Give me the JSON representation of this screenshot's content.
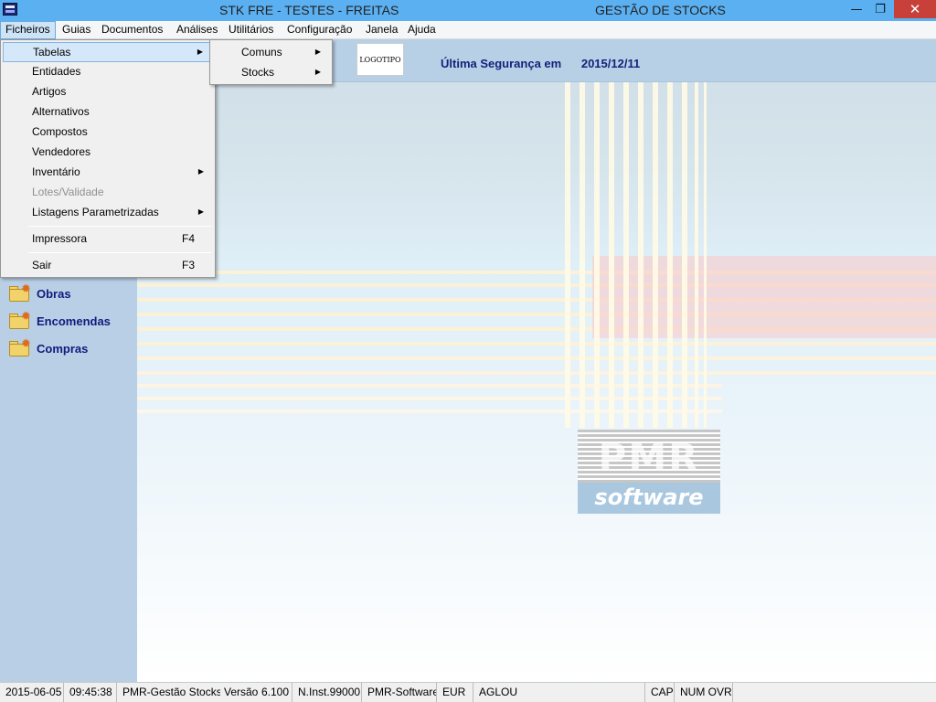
{
  "window": {
    "title_left": "STK FRE - TESTES - FREITAS",
    "title_right": "GESTÃO DE STOCKS",
    "minimize": "—",
    "restore": "❐",
    "close": "✕"
  },
  "menubar": {
    "items": [
      "Ficheiros",
      "Guias",
      "Documentos",
      "Análises",
      "Utilitários",
      "Configuração",
      "Janela",
      "Ajuda"
    ]
  },
  "ficheiros_menu": {
    "items": [
      {
        "label": "Tabelas",
        "arrow": "▶"
      },
      {
        "label": "Entidades"
      },
      {
        "label": "Artigos"
      },
      {
        "label": "Alternativos"
      },
      {
        "label": "Compostos"
      },
      {
        "label": "Vendedores"
      },
      {
        "label": "Inventário",
        "arrow": "▶"
      },
      {
        "label": "Lotes/Validade"
      },
      {
        "label": "Listagens Parametrizadas",
        "arrow": "▶"
      },
      {
        "label": "Impressora",
        "shortcut": "F4"
      },
      {
        "label": "Sair",
        "shortcut": "F3"
      }
    ]
  },
  "tabelas_submenu": {
    "items": [
      {
        "label": "Comuns",
        "arrow": "▶"
      },
      {
        "label": "Stocks",
        "arrow": "▶"
      }
    ]
  },
  "header": {
    "logo_text": "LOGOTIPO",
    "backup_label": "Última Segurança em",
    "backup_date": "2015/12/11"
  },
  "left_pane": {
    "folders": [
      "Obras",
      "Encomendas",
      "Compras"
    ]
  },
  "brand": {
    "pmr": "PMR",
    "software": "software"
  },
  "statusbar": {
    "date": "2015-06-05",
    "time": "09:45:38",
    "app": "PMR-Gestão Stocks",
    "version_label": "Versão",
    "version": "6.100",
    "installation": "N.Inst.99000",
    "vendor": "PMR-Software",
    "currency": "EUR",
    "user": "AGLOU",
    "cap": "CAP",
    "num_ovr": "NUM OVR"
  }
}
